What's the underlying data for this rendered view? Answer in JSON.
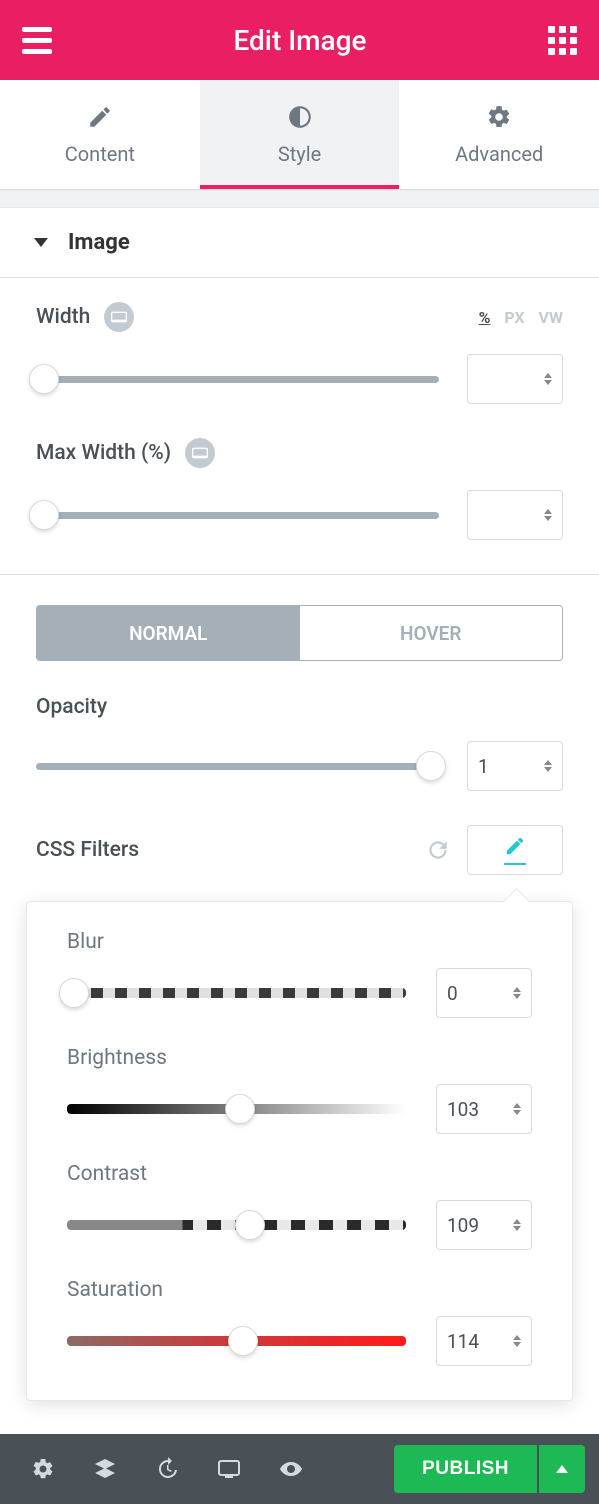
{
  "header": {
    "title": "Edit Image"
  },
  "tabs": {
    "content": "Content",
    "style": "Style",
    "advanced": "Advanced"
  },
  "section": {
    "image_title": "Image"
  },
  "controls": {
    "width": {
      "label": "Width",
      "value": "",
      "units": [
        "%",
        "PX",
        "VW"
      ],
      "active_unit": "%"
    },
    "max_width": {
      "label": "Max Width (%)",
      "value": ""
    },
    "segmented": {
      "normal": "NORMAL",
      "hover": "HOVER"
    },
    "opacity": {
      "label": "Opacity",
      "value": "1"
    },
    "css_filters": {
      "label": "CSS Filters"
    }
  },
  "filters": {
    "blur": {
      "label": "Blur",
      "value": "0"
    },
    "brightness": {
      "label": "Brightness",
      "value": "103"
    },
    "contrast": {
      "label": "Contrast",
      "value": "109"
    },
    "saturation": {
      "label": "Saturation",
      "value": "114"
    }
  },
  "footer": {
    "publish": "PUBLISH"
  }
}
